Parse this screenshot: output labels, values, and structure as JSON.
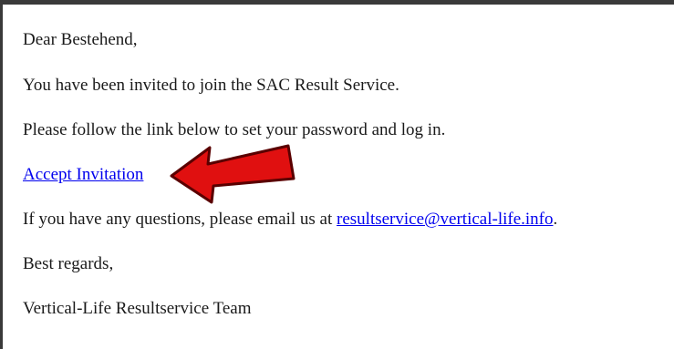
{
  "email": {
    "greeting": "Dear Bestehend,",
    "intro": "You have been invited to join the SAC Result Service.",
    "instruction": "Please follow the link below to set your password and log in.",
    "accept_link": "Accept Invitation",
    "questions_prefix": "If you have any questions, please email us at ",
    "contact_email": "resultservice@vertical-life.info",
    "questions_suffix": ".",
    "closing": "Best regards,",
    "signature": "Vertical-Life Resultservice Team"
  },
  "annotation": {
    "arrow_color": "#e01010",
    "arrow_outline": "#5a0000",
    "arrow_icon": "red-arrow-pointing-left-icon"
  }
}
